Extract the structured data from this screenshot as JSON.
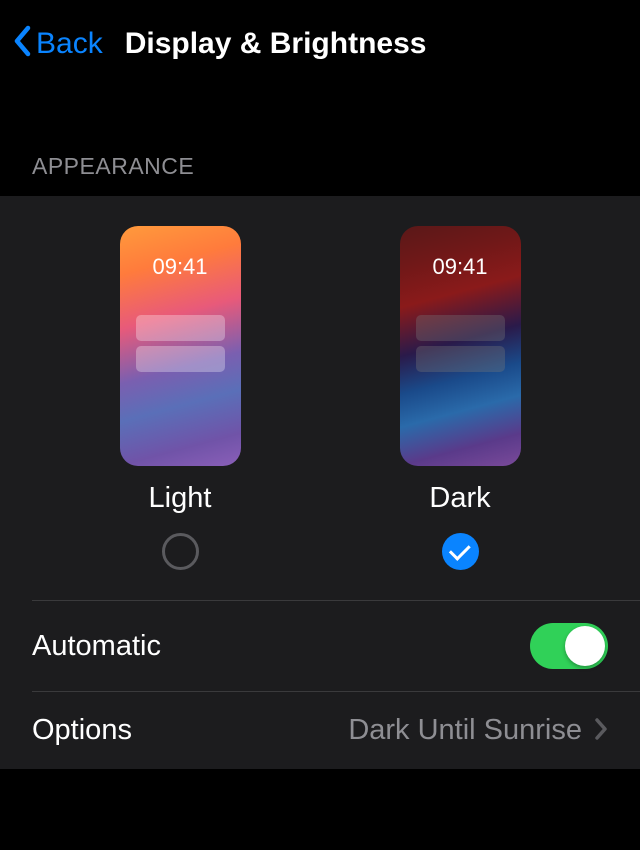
{
  "nav": {
    "back_label": "Back",
    "title": "Display & Brightness"
  },
  "section_header": "APPEARANCE",
  "appearance": {
    "preview_time": "09:41",
    "options": [
      {
        "label": "Light",
        "selected": false
      },
      {
        "label": "Dark",
        "selected": true
      }
    ]
  },
  "automatic": {
    "label": "Automatic",
    "enabled": true
  },
  "options_row": {
    "label": "Options",
    "value": "Dark Until Sunrise"
  },
  "colors": {
    "accent": "#0a84ff",
    "toggle_on": "#30d158",
    "background": "#000000",
    "section_bg": "#1c1c1e",
    "secondary_text": "#8e8e93"
  }
}
